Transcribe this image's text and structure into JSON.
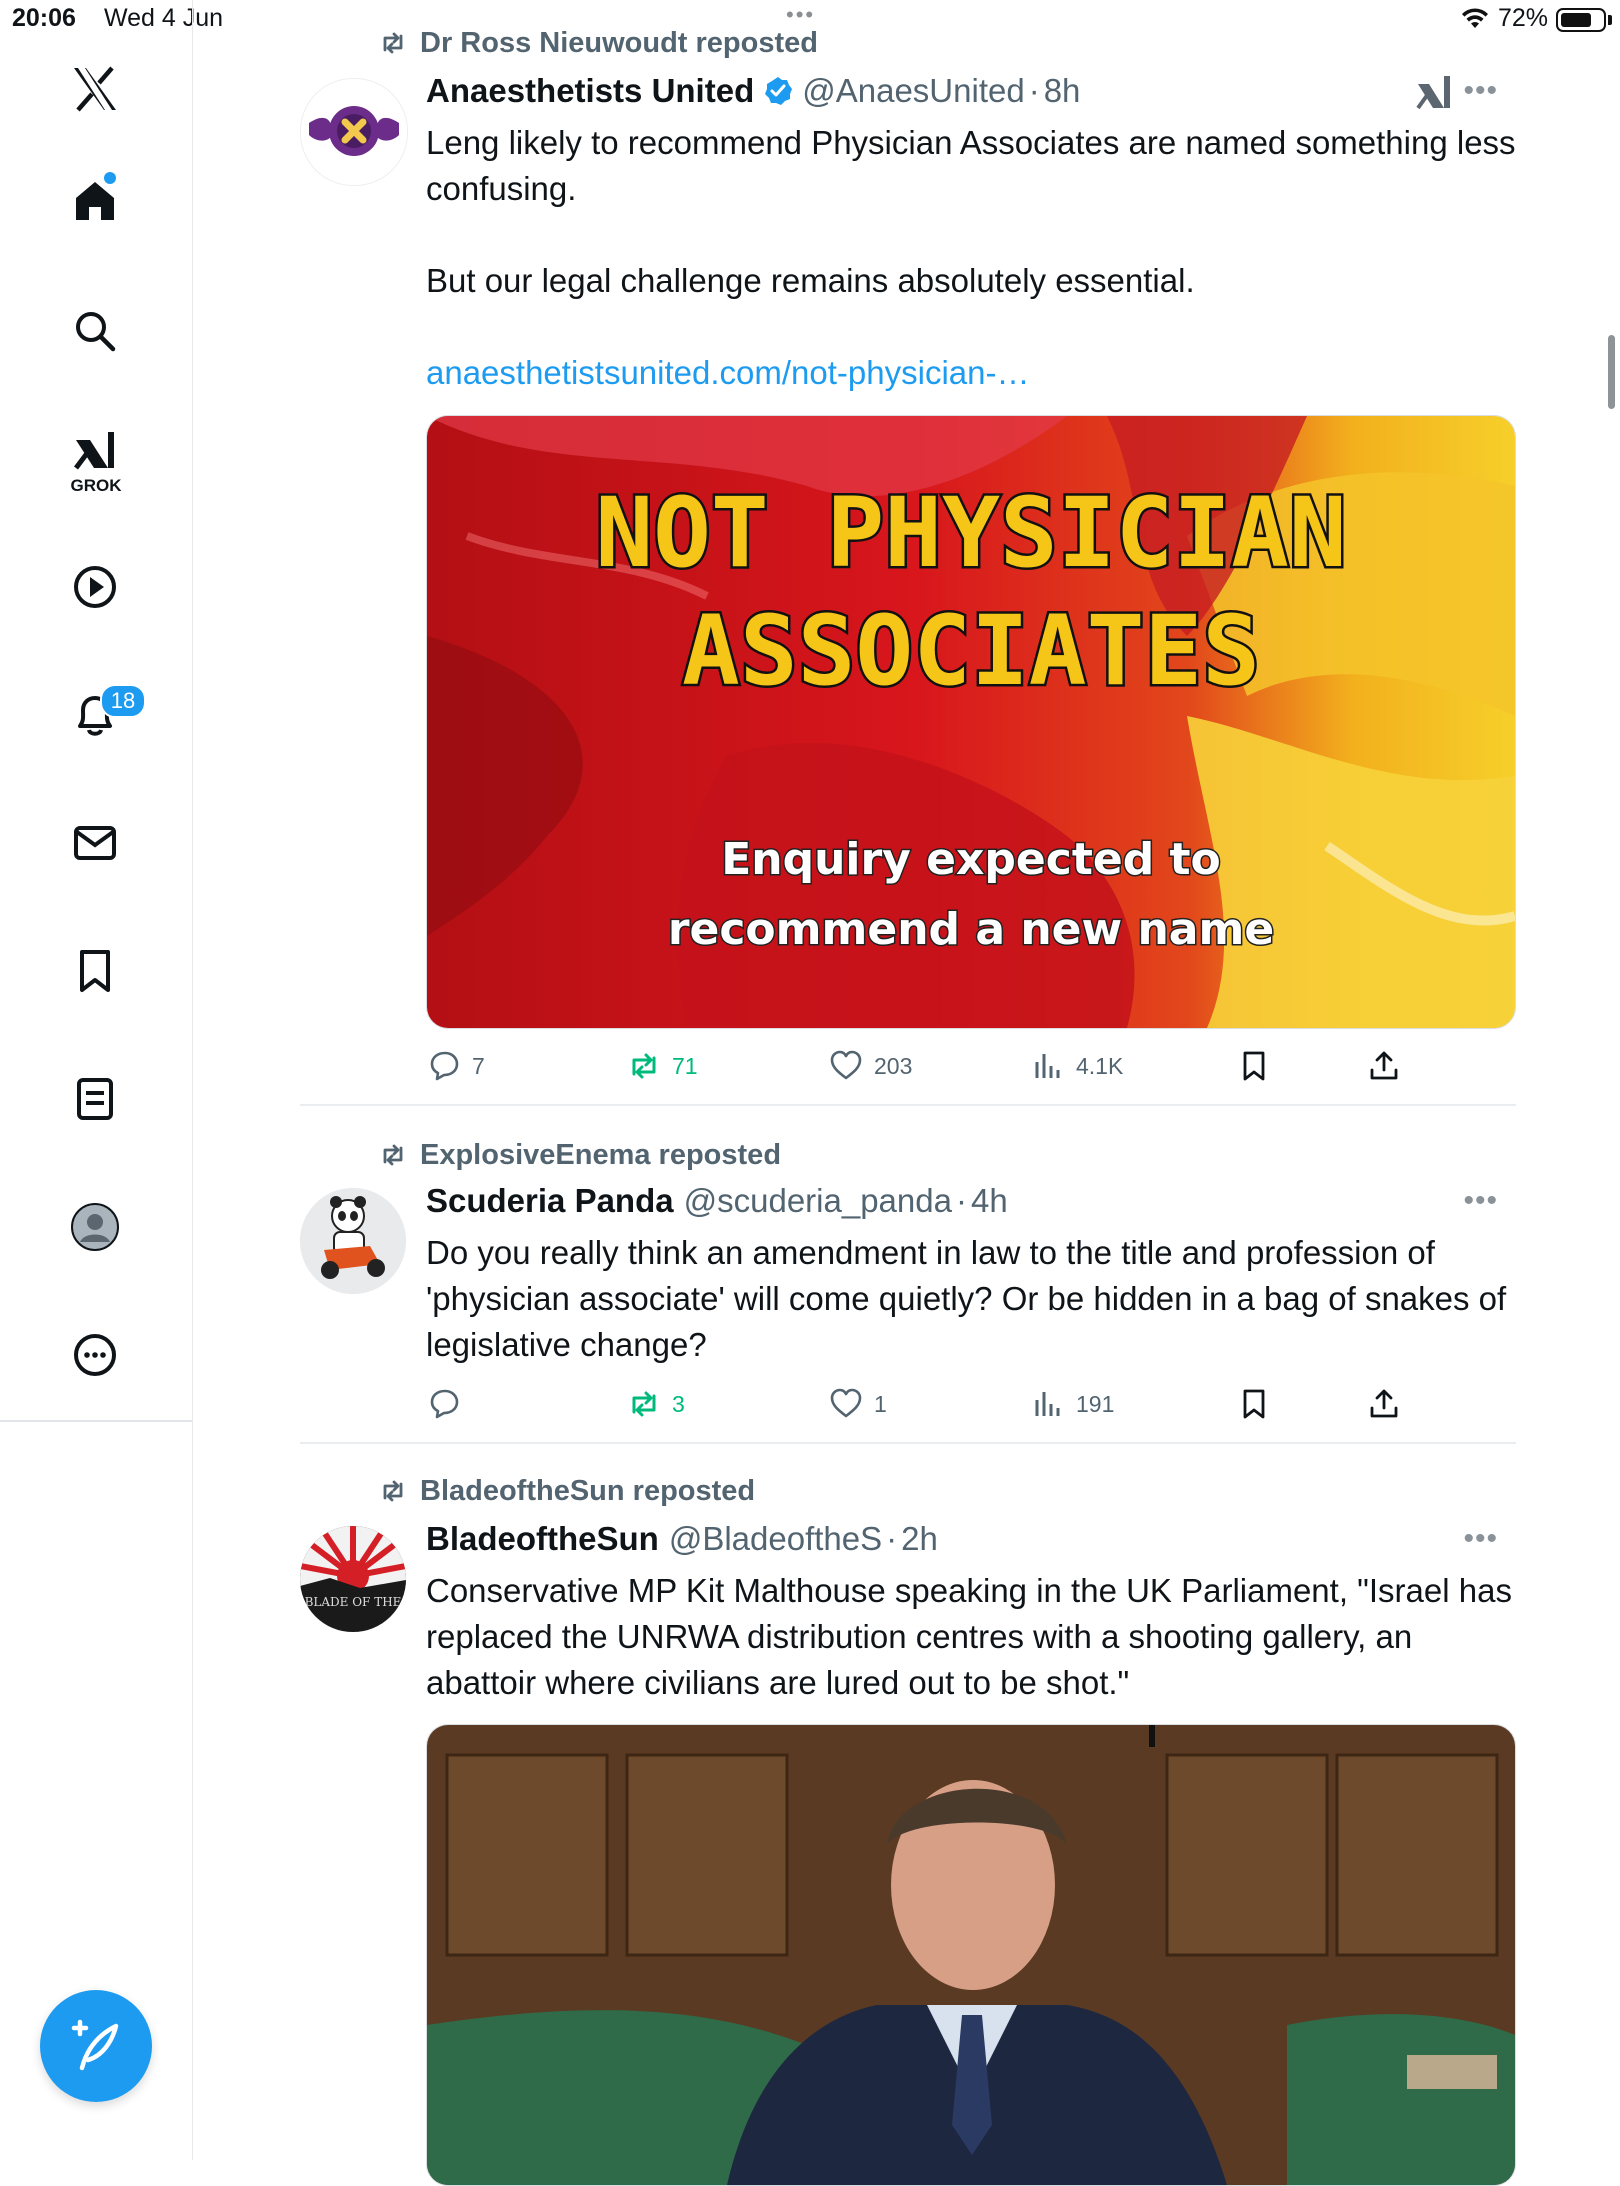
{
  "status_bar": {
    "time": "20:06",
    "date": "Wed 4 Jun",
    "battery": "72%"
  },
  "sidebar": {
    "items": [
      {
        "name": "home",
        "icon": "home-icon",
        "active": true
      },
      {
        "name": "explore",
        "icon": "search-icon"
      },
      {
        "name": "grok",
        "icon": "grok-icon",
        "label": "GROK"
      },
      {
        "name": "video",
        "icon": "play-icon"
      },
      {
        "name": "notifications",
        "icon": "bell-icon",
        "badge": "18"
      },
      {
        "name": "messages",
        "icon": "mail-icon"
      },
      {
        "name": "bookmarks",
        "icon": "bookmark-icon"
      },
      {
        "name": "articles",
        "icon": "article-icon"
      },
      {
        "name": "profile",
        "icon": "avatar-icon"
      },
      {
        "name": "more",
        "icon": "more-circle-icon"
      }
    ],
    "compose_icon": "compose-icon"
  },
  "tweets": [
    {
      "repost_by": "Dr Ross Nieuwoudt reposted",
      "display_name": "Anaesthetists United",
      "verified": true,
      "handle": "@AnaesUnited",
      "time": "8h",
      "text": "Leng likely to recommend Physician Associates are named something less confusing.\n\nBut our legal challenge remains absolutely essential.\n\n",
      "link": "anaesthetistsunited.com/not-physician-…",
      "media": {
        "title_line1": "NOT PHYSICIAN",
        "title_line2": "ASSOCIATES",
        "subtitle_line1": "Enquiry expected to",
        "subtitle_line2": "recommend a new name"
      },
      "stats": {
        "replies": "7",
        "reposts": "71",
        "likes": "203",
        "views": "4.1K"
      }
    },
    {
      "repost_by": "ExplosiveEnema reposted",
      "display_name": "Scuderia Panda",
      "handle": "@scuderia_panda",
      "time": "4h",
      "text": "Do you really think an amendment in law to the title and profession of 'physician associate' will come quietly? Or be hidden in a bag of snakes of legislative change?",
      "stats": {
        "replies": "",
        "reposts": "3",
        "likes": "1",
        "views": "191"
      }
    },
    {
      "repost_by": "BladeoftheSun reposted",
      "display_name": "BladeoftheSun",
      "handle": "@BladeoftheS",
      "time": "2h",
      "text": "Conservative MP Kit Malthouse speaking in the UK Parliament, \"Israel has replaced the UNRWA distribution centres with a shooting gallery, an abattoir where civilians are lured out to be shot.\"",
      "avatar_text": "BLADE OF THE"
    }
  ],
  "colors": {
    "accent": "#1d9bf0",
    "repost_green": "#00ba7c",
    "muted": "#536471"
  }
}
